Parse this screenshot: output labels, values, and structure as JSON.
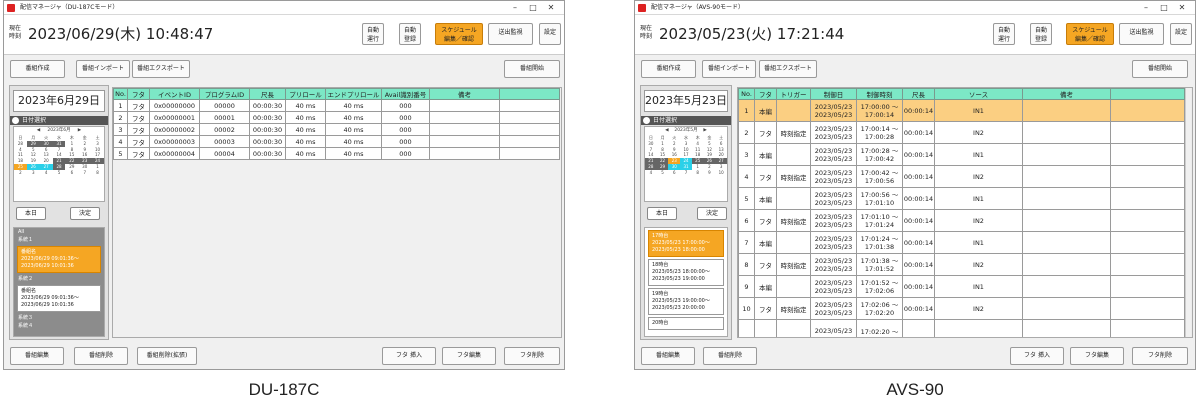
{
  "left_panel": {
    "window_title": "配信マネージャ（DU-187Cモード）",
    "clock_label": "現在\n時刻",
    "clock": "2023/06/29(木) 10:48:47",
    "header_buttons": [
      {
        "label": "自動\n運行",
        "orange": false
      },
      {
        "label": "自動\n登録",
        "orange": false
      },
      {
        "label": "スケジュール\n編集／確認",
        "orange": true
      },
      {
        "label": "送出監視",
        "orange": false
      },
      {
        "label": "設定",
        "orange": false
      }
    ],
    "toolbar_buttons": [
      "番組作成",
      "番組インポート",
      "番組エクスポート"
    ],
    "start_button": "番組開始",
    "date_display": "2023年6月29日",
    "date_select": "日付選択",
    "calendar": {
      "month": "2023年6月",
      "weekdays": [
        "日",
        "月",
        "火",
        "水",
        "木",
        "金",
        "土"
      ],
      "days": [
        "28",
        "29",
        "30",
        "31",
        "1",
        "2",
        "3",
        "4",
        "5",
        "6",
        "7",
        "8",
        "9",
        "10",
        "11",
        "12",
        "13",
        "14",
        "15",
        "16",
        "17",
        "18",
        "19",
        "20",
        "21",
        "22",
        "23",
        "24",
        "25",
        "26",
        "27",
        "28",
        "29",
        "30",
        "1",
        "2",
        "3",
        "4",
        "5",
        "6",
        "7",
        "8"
      ]
    },
    "today_button": "本日",
    "ok_button": "決定",
    "program_all": "All",
    "program_groups": [
      {
        "group": "系統１",
        "items": [
          {
            "text": "番組名\n2023/06/29 09:01:36～\n2023/06/29 10:01:36",
            "selected": true
          }
        ]
      },
      {
        "group": "系統２",
        "items": [
          {
            "text": "番組名\n2023/06/29 09:01:36～\n2023/06/29 10:01:36",
            "selected": false
          }
        ]
      },
      {
        "group": "系統３",
        "items": []
      },
      {
        "group": "系統４",
        "items": []
      }
    ],
    "table": {
      "headers": [
        "No.",
        "フタ",
        "イベントID",
        "プログラムID",
        "尺長",
        "プリロール",
        "エンドプリロール",
        "Avail識別番号",
        "備考",
        ""
      ],
      "rows": [
        [
          "1",
          "フタ",
          "0x00000000",
          "00000",
          "00:00:30",
          "40 ms",
          "40 ms",
          "000",
          "",
          ""
        ],
        [
          "2",
          "フタ",
          "0x00000001",
          "00001",
          "00:00:30",
          "40 ms",
          "40 ms",
          "000",
          "",
          ""
        ],
        [
          "3",
          "フタ",
          "0x00000002",
          "00002",
          "00:00:30",
          "40 ms",
          "40 ms",
          "000",
          "",
          ""
        ],
        [
          "4",
          "フタ",
          "0x00000003",
          "00003",
          "00:00:30",
          "40 ms",
          "40 ms",
          "000",
          "",
          ""
        ],
        [
          "5",
          "フタ",
          "0x00000004",
          "00004",
          "00:00:30",
          "40 ms",
          "40 ms",
          "000",
          "",
          ""
        ]
      ]
    },
    "bottom_buttons": [
      "番組編集",
      "番組削除",
      "番組削除(拡張)"
    ],
    "bottom_right_buttons": [
      "フタ 挿入",
      "フタ編集",
      "フタ削除"
    ],
    "caption": "DU-187C"
  },
  "right_panel": {
    "window_title": "配信マネージャ（AVS-90モード）",
    "clock_label": "現在\n時刻",
    "clock": "2023/05/23(火) 17:21:44",
    "header_buttons": [
      {
        "label": "自動\n運行",
        "orange": false
      },
      {
        "label": "自動\n登録",
        "orange": false
      },
      {
        "label": "スケジュール\n編集／確認",
        "orange": true
      },
      {
        "label": "送出監視",
        "orange": false
      },
      {
        "label": "設定",
        "orange": false
      }
    ],
    "toolbar_buttons": [
      "番組作成",
      "番組インポート",
      "番組エクスポート"
    ],
    "start_button": "番組開始",
    "date_display": "2023年5月23日",
    "date_select": "日付選択",
    "calendar": {
      "month": "2023年5月",
      "weekdays": [
        "日",
        "月",
        "火",
        "水",
        "木",
        "金",
        "土"
      ],
      "days": [
        "30",
        "1",
        "2",
        "3",
        "4",
        "5",
        "6",
        "7",
        "8",
        "9",
        "10",
        "11",
        "12",
        "13",
        "14",
        "15",
        "16",
        "17",
        "18",
        "19",
        "20",
        "21",
        "22",
        "23",
        "24",
        "25",
        "26",
        "27",
        "28",
        "29",
        "30",
        "31",
        "1",
        "2",
        "3",
        "4",
        "5",
        "6",
        "7",
        "8",
        "9",
        "10"
      ]
    },
    "today_button": "本日",
    "ok_button": "決定",
    "programs": [
      {
        "text": "17時台\n2023/05/23 17:00:00～\n2023/05/23 18:00:00",
        "selected": true
      },
      {
        "text": "18時台\n2023/05/23 18:00:00～\n2023/05/23 19:00:00",
        "selected": false
      },
      {
        "text": "19時台\n2023/05/23 19:00:00～\n2023/05/23 20:00:00",
        "selected": false
      },
      {
        "text": "20時台",
        "selected": false
      }
    ],
    "table": {
      "headers": [
        "No.",
        "フタ",
        "トリガー",
        "制御日",
        "制御時刻",
        "尺長",
        "ソース",
        "備考",
        ""
      ],
      "rows": [
        [
          "1",
          "本編",
          "",
          "2023/05/23\n2023/05/23",
          "17:00:00 ～\n17:00:14",
          "00:00:14",
          "IN1",
          "",
          ""
        ],
        [
          "2",
          "フタ",
          "時刻指定",
          "2023/05/23\n2023/05/23",
          "17:00:14 ～\n17:00:28",
          "00:00:14",
          "IN2",
          "",
          ""
        ],
        [
          "3",
          "本編",
          "",
          "2023/05/23\n2023/05/23",
          "17:00:28 ～\n17:00:42",
          "00:00:14",
          "IN1",
          "",
          ""
        ],
        [
          "4",
          "フタ",
          "時刻指定",
          "2023/05/23\n2023/05/23",
          "17:00:42 ～\n17:00:56",
          "00:00:14",
          "IN2",
          "",
          ""
        ],
        [
          "5",
          "本編",
          "",
          "2023/05/23\n2023/05/23",
          "17:00:56 ～\n17:01:10",
          "00:00:14",
          "IN1",
          "",
          ""
        ],
        [
          "6",
          "フタ",
          "時刻指定",
          "2023/05/23\n2023/05/23",
          "17:01:10 ～\n17:01:24",
          "00:00:14",
          "IN2",
          "",
          ""
        ],
        [
          "7",
          "本編",
          "",
          "2023/05/23\n2023/05/23",
          "17:01:24 ～\n17:01:38",
          "00:00:14",
          "IN1",
          "",
          ""
        ],
        [
          "8",
          "フタ",
          "時刻指定",
          "2023/05/23\n2023/05/23",
          "17:01:38 ～\n17:01:52",
          "00:00:14",
          "IN2",
          "",
          ""
        ],
        [
          "9",
          "本編",
          "",
          "2023/05/23\n2023/05/23",
          "17:01:52 ～\n17:02:06",
          "00:00:14",
          "IN1",
          "",
          ""
        ],
        [
          "10",
          "フタ",
          "時刻指定",
          "2023/05/23\n2023/05/23",
          "17:02:06 ～\n17:02:20",
          "00:00:14",
          "IN2",
          "",
          ""
        ],
        [
          "",
          "",
          "",
          "2023/05/23",
          "17:02:20 ～",
          "",
          "",
          "",
          ""
        ]
      ]
    },
    "bottom_buttons": [
      "番組編集",
      "番組削除"
    ],
    "bottom_right_buttons": [
      "フタ 挿入",
      "フタ編集",
      "フタ削除"
    ],
    "caption": "AVS-90"
  },
  "colors": {
    "accent_orange": "#f5a623",
    "header_green": "#7ce8c6",
    "selected_row": "#fbcf82",
    "calendar_cyan": "#2ad0e8"
  }
}
